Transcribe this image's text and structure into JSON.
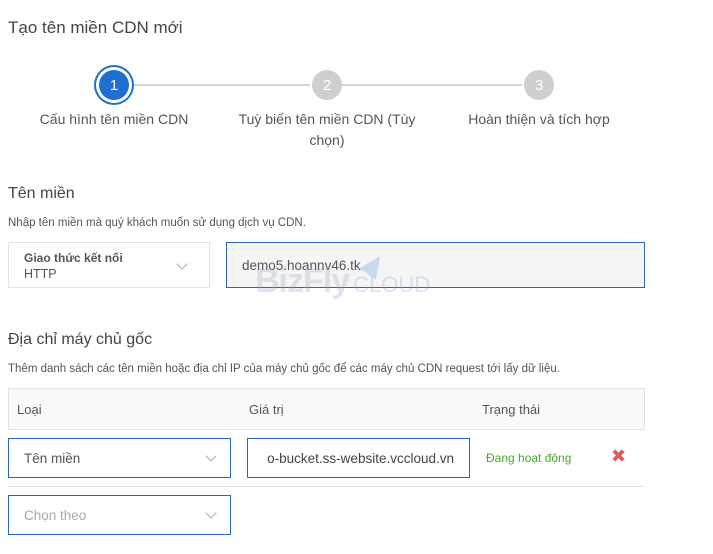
{
  "page": {
    "title": "Tạo tên miền CDN mới"
  },
  "stepper": {
    "steps": [
      {
        "number": "1",
        "label": "Cấu hình tên miền CDN"
      },
      {
        "number": "2",
        "label": "Tuỳ biến tên miền CDN (Tùy chọn)"
      },
      {
        "number": "3",
        "label": "Hoàn thiện và tích hợp"
      }
    ],
    "active_step": 1
  },
  "domain_section": {
    "title": "Tên miền",
    "help": "Nhập tên miền mà quý khách muốn sử dụng dịch vụ CDN.",
    "protocol_label": "Giao thức kết nối",
    "protocol_value": "HTTP",
    "domain_value": "demo5.hoannv46.tk"
  },
  "watermark": {
    "brand": "BizFly",
    "suffix": "CLOUD"
  },
  "origin_section": {
    "title": "Địa chỉ máy chủ gốc",
    "help": "Thêm danh sách các tên miền hoặc địa chỉ IP của máy chủ gốc để các máy chủ CDN request tới lấy dữ liệu.",
    "columns": [
      "Loại",
      "Giá trị",
      "Trạng thái"
    ],
    "rows": [
      {
        "type": "Tên miền",
        "value": "o-bucket.ss-website.vccloud.vn",
        "status": "Đang hoạt động"
      }
    ],
    "new_row_placeholder": "Chọn theo"
  },
  "colors": {
    "accent": "#1f6fd1",
    "input_border": "#2b66b4",
    "status_active": "#4aa82b",
    "delete": "#e05a5a"
  }
}
